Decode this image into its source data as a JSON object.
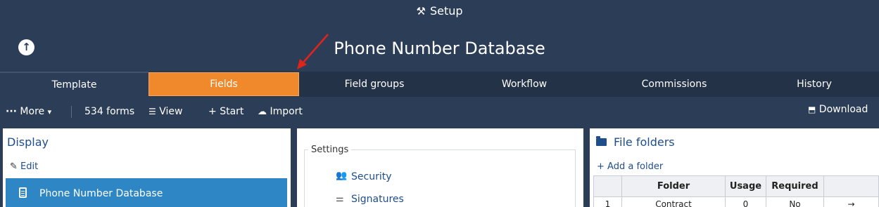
{
  "header": {
    "setup_label": "Setup",
    "setup_icon": "tools-icon",
    "title": "Phone Number Database"
  },
  "tabs": [
    {
      "label": "Template"
    },
    {
      "label": "Fields"
    },
    {
      "label": "Field groups"
    },
    {
      "label": "Workflow"
    },
    {
      "label": "Commissions"
    },
    {
      "label": "History"
    }
  ],
  "toolbar": {
    "more": "More",
    "forms_count": "534 forms",
    "view": "View",
    "start": "Start",
    "import": "Import",
    "download": "Download"
  },
  "display_panel": {
    "title": "Display",
    "edit": "Edit",
    "selected_form": "Phone Number Database"
  },
  "settings_panel": {
    "legend": "Settings",
    "items": [
      {
        "label": "Security"
      },
      {
        "label": "Signatures"
      }
    ]
  },
  "folders_panel": {
    "title": "File folders",
    "add": "Add a folder",
    "columns": [
      "Folder",
      "Usage",
      "Required"
    ],
    "rows": [
      {
        "index": "1",
        "folder": "Contract",
        "usage": "0",
        "required": "No"
      }
    ]
  },
  "colors": {
    "header_bg": "#2c3e57",
    "tab_bar_bg": "#233246",
    "active_tab": "#f0892b",
    "selected_item": "#2f86c4",
    "link": "#1f4e8a"
  }
}
